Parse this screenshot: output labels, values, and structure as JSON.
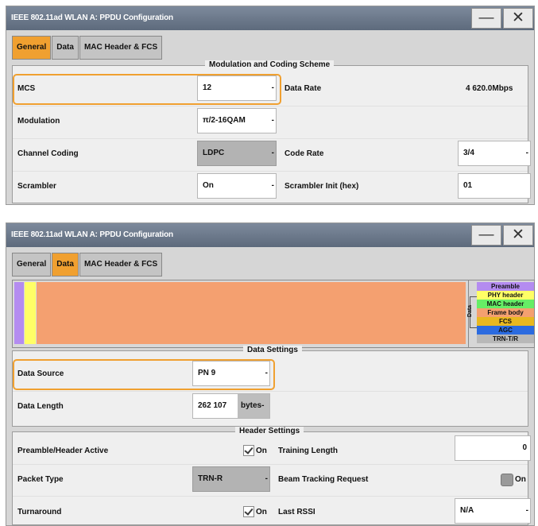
{
  "window1": {
    "title": "IEEE 802.11ad WLAN A: PPDU Configuration",
    "minimize_glyph": "—",
    "close_glyph": "✕",
    "tabs": [
      "General",
      "Data",
      "MAC Header & FCS"
    ],
    "active_tab": "General",
    "section_title": "Modulation and Coding Scheme",
    "rows": {
      "mcs": {
        "label": "MCS",
        "value": "12"
      },
      "data_rate": {
        "label": "Data Rate",
        "value": "4 620.0Mbps"
      },
      "modulation": {
        "label": "Modulation",
        "value": "π/2-16QAM"
      },
      "channel_coding": {
        "label": "Channel Coding",
        "value": "LDPC"
      },
      "code_rate": {
        "label": "Code Rate",
        "value": "3/4"
      },
      "scrambler": {
        "label": "Scrambler",
        "value": "On"
      },
      "scrambler_init": {
        "label": "Scrambler Init (hex)",
        "value": "01"
      }
    },
    "dropdown_glyph": "-"
  },
  "window2": {
    "title": "IEEE 802.11ad WLAN A: PPDU Configuration",
    "minimize_glyph": "—",
    "close_glyph": "✕",
    "tabs": [
      "General",
      "Data",
      "MAC Header & FCS"
    ],
    "active_tab": "Data",
    "frame_legend": {
      "side_label": "Data",
      "items": [
        {
          "label": "Preamble",
          "color": "#b48cf0"
        },
        {
          "label": "PHY header",
          "color": "#ffff66"
        },
        {
          "label": "MAC header",
          "color": "#66ee66"
        },
        {
          "label": "Frame body",
          "color": "#f4a070"
        },
        {
          "label": "FCS",
          "color": "#e8b820"
        },
        {
          "label": "AGC",
          "color": "#2b6be0"
        },
        {
          "label": "TRN-T/R",
          "color": "#b8b8b8"
        }
      ]
    },
    "data_settings": {
      "title": "Data Settings",
      "data_source": {
        "label": "Data Source",
        "value": "PN 9"
      },
      "data_length": {
        "label": "Data Length",
        "value": "262 107",
        "unit": "bytes"
      }
    },
    "header_settings": {
      "title": "Header Settings",
      "preamble_header_active": {
        "label": "Preamble/Header Active",
        "state": "On",
        "checked": true
      },
      "training_length": {
        "label": "Training Length",
        "value": "0"
      },
      "packet_type": {
        "label": "Packet Type",
        "value": "TRN-R"
      },
      "beam_tracking_request": {
        "label": "Beam Tracking Request",
        "state": "On",
        "checked": false
      },
      "turnaround": {
        "label": "Turnaround",
        "state": "On",
        "checked": true
      },
      "last_rssi": {
        "label": "Last RSSI",
        "value": "N/A"
      }
    },
    "dropdown_glyph": "-"
  },
  "colors": {
    "active_tab": "#f0a030",
    "titlebar": "#6a7789",
    "highlight": "#f0a030"
  }
}
